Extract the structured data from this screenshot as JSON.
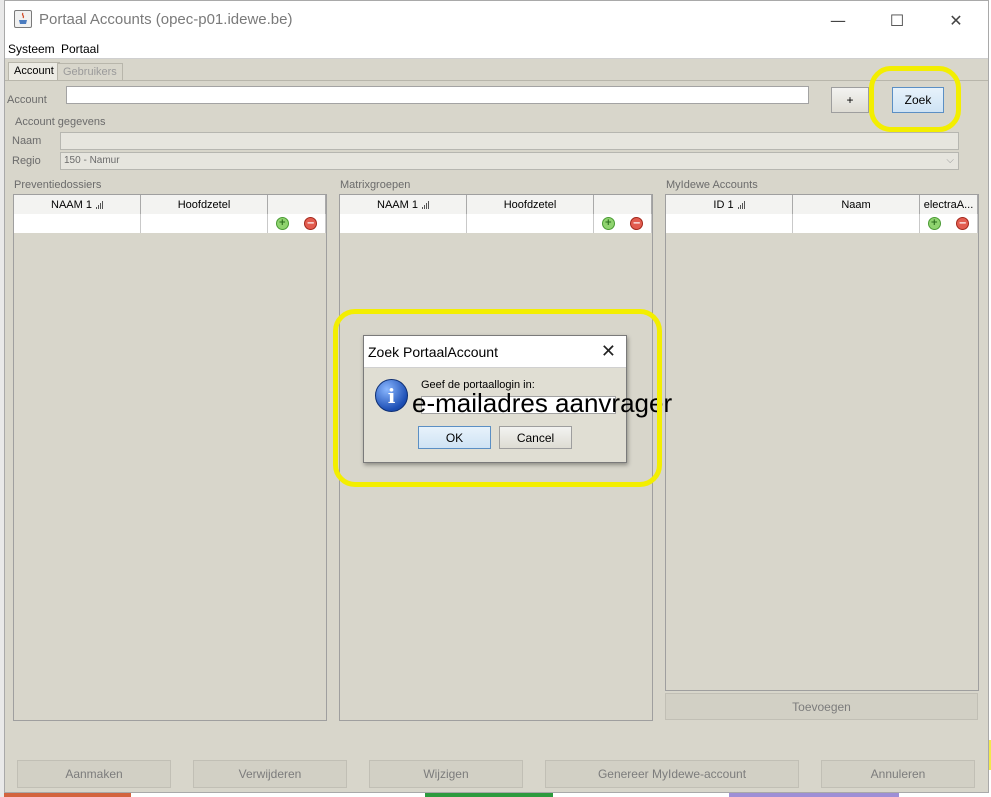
{
  "window": {
    "title": "Portaal Accounts (opec-p01.idewe.be)",
    "minimize_glyph": "—",
    "maximize_glyph": "☐",
    "close_glyph": "✕"
  },
  "menu": {
    "items": [
      {
        "label": "Systeem"
      },
      {
        "label": "Portaal"
      }
    ]
  },
  "tabs": [
    {
      "label": "Account",
      "active": true
    },
    {
      "label": "Gebruikers",
      "active": false
    }
  ],
  "search": {
    "label": "Account",
    "value": "",
    "add_label": "+",
    "search_label": "Zoek"
  },
  "account_details": {
    "section_title": "Account gegevens",
    "name_label": "Naam",
    "name_value": "",
    "region_label": "Regio",
    "region_value": "150 - Namur"
  },
  "panels": {
    "preventiedossiers": {
      "title": "Preventiedossiers",
      "columns": [
        "NAAM 1",
        "Hoofdzetel",
        ""
      ]
    },
    "matrixgroepen": {
      "title": "Matrixgroepen",
      "columns": [
        "NAAM 1",
        "Hoofdzetel",
        ""
      ]
    },
    "myidewe": {
      "title": "MyIdewe Accounts",
      "columns": [
        "ID 1",
        "Naam",
        "electraA..."
      ],
      "add_button": "Toevoegen"
    }
  },
  "footer": {
    "buttons": [
      "Aanmaken",
      "Verwijderen",
      "Wijzigen",
      "Genereer MyIdewe-account",
      "Annuleren"
    ]
  },
  "dialog": {
    "title": "Zoek PortaalAccount",
    "close_glyph": "✕",
    "icon_glyph": "i",
    "prompt": "Geef de portaallogin in:",
    "value": "e-mailadres aanvrager",
    "ok_label": "OK",
    "cancel_label": "Cancel"
  },
  "colors": {
    "highlight": "#f3ee00",
    "window_bg": "#d8d6cb",
    "focus_button": "#cfe3f4"
  }
}
